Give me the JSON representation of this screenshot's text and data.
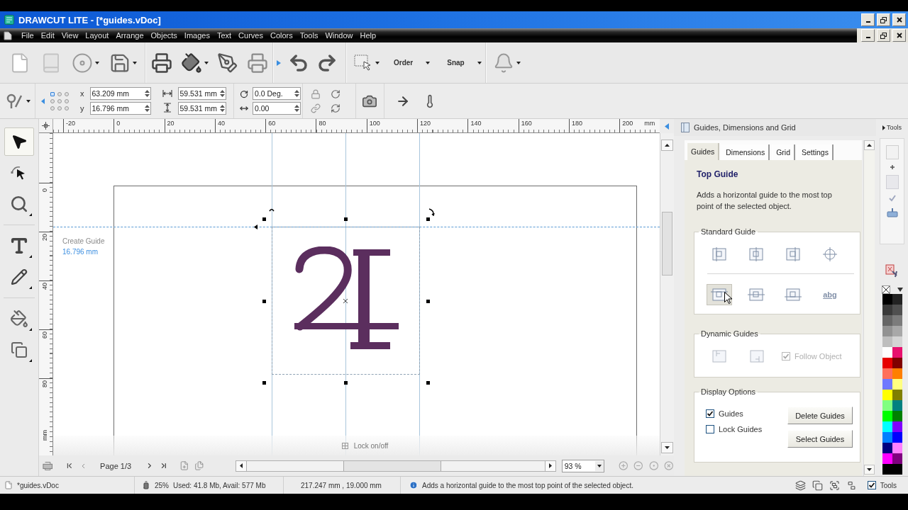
{
  "title_bar": {
    "title": "DRAWCUT LITE - [*guides.vDoc]"
  },
  "menu_bar": {
    "items": [
      "File",
      "Edit",
      "View",
      "Layout",
      "Arrange",
      "Objects",
      "Images",
      "Text",
      "Curves",
      "Colors",
      "Tools",
      "Window",
      "Help"
    ]
  },
  "toolbar": {
    "dropdowns": [
      {
        "label": "Order"
      },
      {
        "label": "Snap"
      }
    ]
  },
  "property_bar": {
    "anchor_points": [
      {
        "selected": true
      },
      {
        "selected": false
      },
      {
        "selected": false
      },
      {
        "selected": false
      },
      {
        "selected": false
      },
      {
        "selected": false
      },
      {
        "selected": false
      },
      {
        "selected": false
      },
      {
        "selected": false
      }
    ],
    "x_label": "x",
    "x": "63.209 mm",
    "y_label": "y",
    "y": "16.796 mm",
    "width": "59.531 mm",
    "height": "59.531 mm",
    "rotation": "0.0 Deg.",
    "skew": "0.00"
  },
  "toolbox": {
    "tools": [
      {
        "kind": "pointer",
        "selected": true
      },
      {
        "kind": "node",
        "selected": false
      },
      {
        "kind": "zoom",
        "selected": false
      },
      {
        "kind": "text",
        "selected": false
      },
      {
        "kind": "pen",
        "selected": false
      },
      {
        "kind": "fill",
        "selected": false
      },
      {
        "kind": "shapes",
        "selected": false
      }
    ]
  },
  "horizontal_ruler": {
    "labels": [
      "-20",
      "0",
      "20",
      "40",
      "60",
      "80",
      "100",
      "120",
      "140",
      "160",
      "180",
      "200"
    ],
    "unit": "mm"
  },
  "vertical_ruler": {
    "labels": [
      "0",
      "20",
      "40",
      "60",
      "80"
    ],
    "unit": "mm"
  },
  "canvas": {
    "guide_hint": {
      "label": "Create Guide",
      "value": "16.796 mm"
    },
    "lock_toggle": "Lock on/off"
  },
  "page_nav": {
    "page": "Page 1/3",
    "zoom": "93 %"
  },
  "panel": {
    "title": "Guides, Dimensions and Grid",
    "tabs": [
      {
        "label": "Guides",
        "selected": true
      },
      {
        "label": "Dimensions",
        "selected": false
      },
      {
        "label": "Grid",
        "selected": false
      },
      {
        "label": "Settings",
        "selected": false
      }
    ],
    "heading": "Top Guide",
    "description": "Adds a horizontal guide to the most top point of the selected object.",
    "standard_guide": {
      "title": "Standard Guide",
      "rows": [
        {
          "buttons": [
            {
              "kind": "left",
              "highlighted": false
            },
            {
              "kind": "center",
              "highlighted": false
            },
            {
              "kind": "right",
              "highlighted": false
            },
            {
              "kind": "crosshair",
              "highlighted": false
            }
          ]
        },
        {
          "buttons": [
            {
              "kind": "top",
              "highlighted": true
            },
            {
              "kind": "middle",
              "highlighted": false
            },
            {
              "kind": "bottom",
              "highlighted": false
            },
            {
              "kind": "baseline",
              "label": "abg",
              "highlighted": false
            }
          ]
        }
      ]
    },
    "dynamic_guides": {
      "title": "Dynamic Guides",
      "disabled": true,
      "buttons": [
        {
          "kind": "start"
        },
        {
          "kind": "end"
        }
      ],
      "follow_object": {
        "label": "Follow Object",
        "checked": true
      }
    },
    "display_options": {
      "title": "Display Options",
      "checkboxes": [
        {
          "label": "Guides",
          "checked": true
        },
        {
          "label": "Lock Guides",
          "checked": false
        }
      ],
      "buttons": [
        "Delete Guides",
        "Select Guides"
      ]
    }
  },
  "palette": {
    "header": "Tools",
    "swatches": [
      {
        "color": "#000000"
      },
      {
        "color": "#222222"
      },
      {
        "color": "#3a3a3a"
      },
      {
        "color": "#505050"
      },
      {
        "color": "#666666"
      },
      {
        "color": "#7c7c7c"
      },
      {
        "color": "#929292"
      },
      {
        "color": "#a8a8a8"
      },
      {
        "color": "#bebebe"
      },
      {
        "color": "#d4d4d4"
      },
      {
        "color": "#ffffff"
      },
      {
        "color": "#e8106e"
      },
      {
        "color": "#e60000"
      },
      {
        "color": "#800000"
      },
      {
        "color": "#ff6f5a"
      },
      {
        "color": "#ff7f00"
      },
      {
        "color": "#6f78ff"
      },
      {
        "color": "#ffff80"
      },
      {
        "color": "#ffff00"
      },
      {
        "color": "#808000"
      },
      {
        "color": "#80ff80"
      },
      {
        "color": "#008080"
      },
      {
        "color": "#00ff00"
      },
      {
        "color": "#008000"
      },
      {
        "color": "#00ffff"
      },
      {
        "color": "#8000ff"
      },
      {
        "color": "#0080ff"
      },
      {
        "color": "#0000ff"
      },
      {
        "color": "#000080"
      },
      {
        "color": "#ff80ff"
      },
      {
        "color": "#ff00ff"
      },
      {
        "color": "#800080"
      },
      {
        "color": "#000000"
      },
      {
        "color": "#000000"
      }
    ]
  },
  "status_bar": {
    "file": "*guides.vDoc",
    "memory_percent": "25%",
    "memory": "Used: 41.8 Mb, Avail: 577 Mb",
    "coordinates": "217.247 mm , 19.000 mm",
    "hint": "Adds a horizontal guide to the most top point of the selected object.",
    "tools": {
      "label": "Tools",
      "checked": true
    }
  }
}
